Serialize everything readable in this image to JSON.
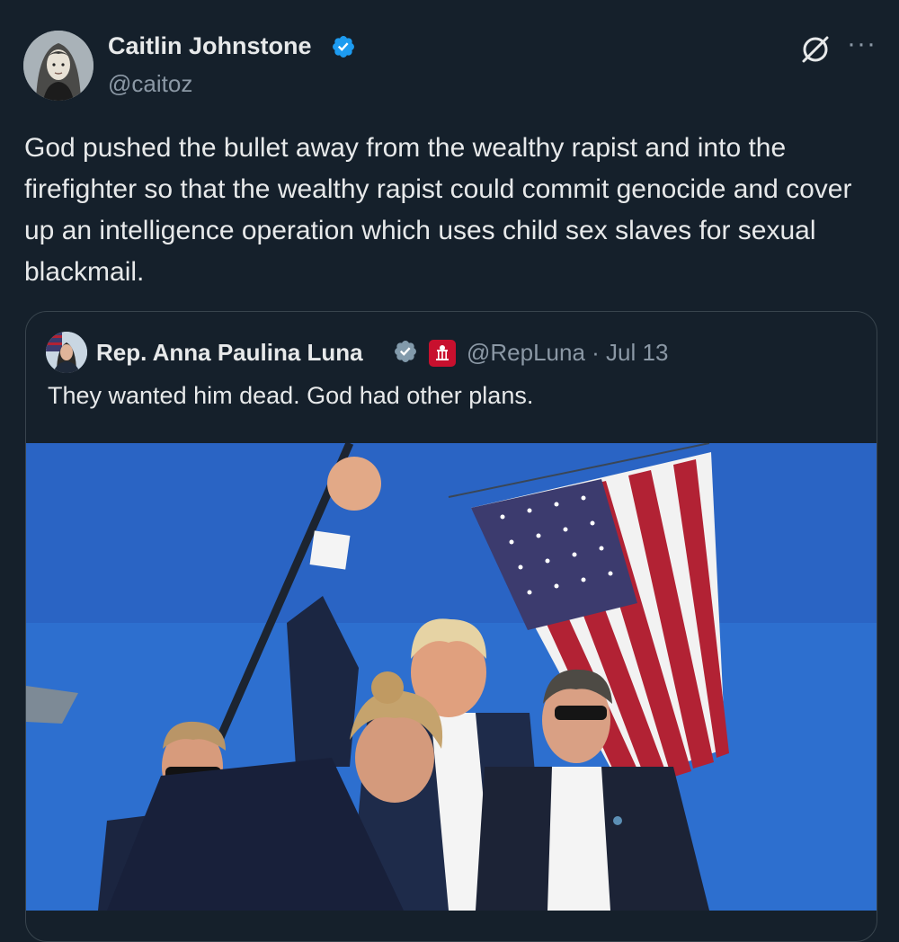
{
  "tweet": {
    "author_name": "Caitlin Johnstone",
    "author_handle": "@caitoz",
    "text": "God pushed the bullet away from the wealthy rapist and into the firefighter so that the wealthy rapist could commit genocide and cover up an intelligence operation which uses child sex slaves for sexual blackmail.",
    "icons": {
      "verified": "verified-badge-icon",
      "grok": "grok-icon",
      "more": "more-icon"
    }
  },
  "quoted": {
    "author_name": "Rep. Anna Paulina Luna",
    "handle_and_date": "@RepLuna · Jul 13",
    "text": "They wanted him dead. God had other plans.",
    "icons": {
      "verified": "verified-badge-icon",
      "government": "capitol-badge-icon"
    }
  },
  "colors": {
    "background": "#15202b",
    "text": "#e7e9ea",
    "secondary_text": "#8b98a5",
    "verified": "#1d9bf0",
    "border": "#38444d",
    "sky": "#2d6fcf",
    "flag_red": "#b22234",
    "flag_blue": "#3c3b6e"
  }
}
